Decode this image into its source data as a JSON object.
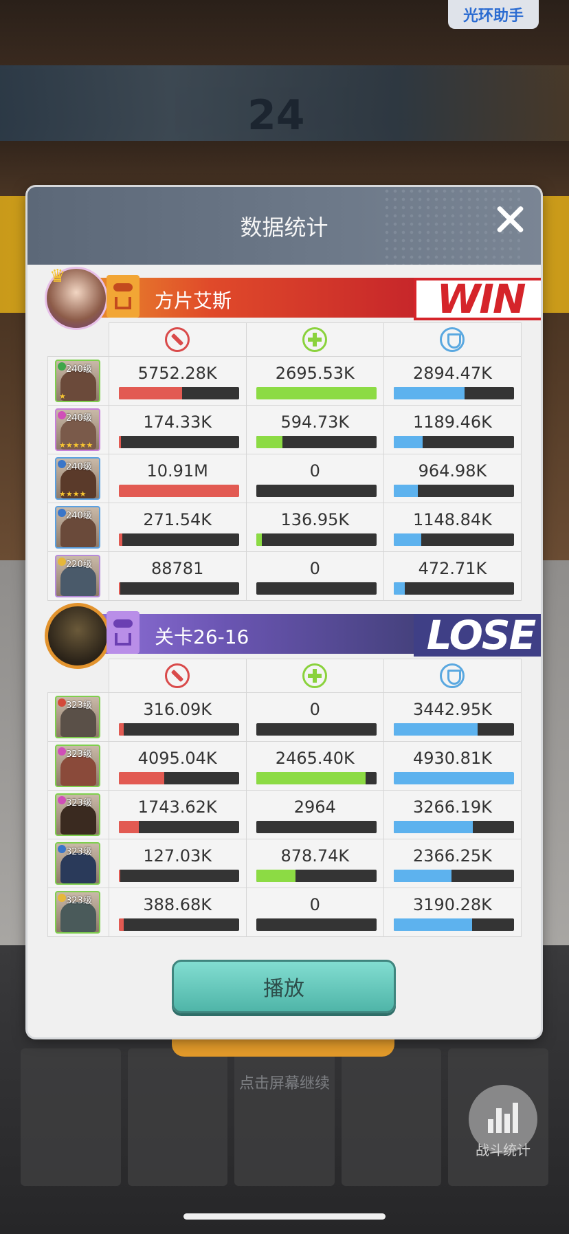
{
  "background": {
    "round_number": "24",
    "tap_hint": "点击屏幕继续",
    "stats_button_label": "战斗统计"
  },
  "halo_button": "光环助手",
  "dialog": {
    "title": "数据统计",
    "play_button": "播放"
  },
  "teams": [
    {
      "name": "方片艾斯",
      "result": "WIN",
      "stat_icons": [
        "sword-icon",
        "cross-icon",
        "shield-icon"
      ],
      "heroes": [
        {
          "level": "240级",
          "stars": "★",
          "badge_color": "#3fa64a",
          "frame_color": "#7fcf4e",
          "face_color": "#6b4a3a",
          "damage": "5752.28K",
          "damage_ratio": 0.53,
          "heal": "2695.53K",
          "heal_ratio": 1.0,
          "tank": "2894.47K",
          "tank_ratio": 0.59
        },
        {
          "level": "240级",
          "stars": "★★★★★",
          "badge_color": "#d04fb8",
          "frame_color": "#c67fd9",
          "face_color": "#7a5a4a",
          "damage": "174.33K",
          "damage_ratio": 0.02,
          "heal": "594.73K",
          "heal_ratio": 0.22,
          "tank": "1189.46K",
          "tank_ratio": 0.24
        },
        {
          "level": "240级",
          "stars": "★★★★",
          "badge_color": "#3a76c9",
          "frame_color": "#5aa0e0",
          "face_color": "#5a3a2a",
          "damage": "10.91M",
          "damage_ratio": 1.0,
          "heal": "0",
          "heal_ratio": 0,
          "tank": "964.98K",
          "tank_ratio": 0.2
        },
        {
          "level": "240级",
          "stars": "",
          "badge_color": "#3a76c9",
          "frame_color": "#5aa0e0",
          "face_color": "#6a4a3a",
          "damage": "271.54K",
          "damage_ratio": 0.03,
          "heal": "136.95K",
          "heal_ratio": 0.05,
          "tank": "1148.84K",
          "tank_ratio": 0.23
        },
        {
          "level": "220级",
          "stars": "",
          "badge_color": "#e6b73a",
          "frame_color": "#b58ad9",
          "face_color": "#4a5a6a",
          "damage": "88781",
          "damage_ratio": 0.01,
          "heal": "0",
          "heal_ratio": 0,
          "tank": "472.71K",
          "tank_ratio": 0.09
        }
      ]
    },
    {
      "name": "关卡26-16",
      "result": "LOSE",
      "stat_icons": [
        "sword-icon",
        "cross-icon",
        "shield-icon"
      ],
      "heroes": [
        {
          "level": "323级",
          "stars": "",
          "badge_color": "#d44a3a",
          "frame_color": "#7fcf4e",
          "face_color": "#5a5048",
          "damage": "316.09K",
          "damage_ratio": 0.04,
          "heal": "0",
          "heal_ratio": 0,
          "tank": "3442.95K",
          "tank_ratio": 0.7
        },
        {
          "level": "323级",
          "stars": "",
          "badge_color": "#d04fb8",
          "frame_color": "#7fcf4e",
          "face_color": "#8a4a3a",
          "damage": "4095.04K",
          "damage_ratio": 0.38,
          "heal": "2465.40K",
          "heal_ratio": 0.91,
          "tank": "4930.81K",
          "tank_ratio": 1.0
        },
        {
          "level": "323级",
          "stars": "",
          "badge_color": "#d04fb8",
          "frame_color": "#7fcf4e",
          "face_color": "#3a2a20",
          "damage": "1743.62K",
          "damage_ratio": 0.17,
          "heal": "2964",
          "heal_ratio": 0,
          "tank": "3266.19K",
          "tank_ratio": 0.66
        },
        {
          "level": "323级",
          "stars": "",
          "badge_color": "#3a76c9",
          "frame_color": "#7fcf4e",
          "face_color": "#2a3a5a",
          "damage": "127.03K",
          "damage_ratio": 0.01,
          "heal": "878.74K",
          "heal_ratio": 0.33,
          "tank": "2366.25K",
          "tank_ratio": 0.48
        },
        {
          "level": "323级",
          "stars": "",
          "badge_color": "#e6b73a",
          "frame_color": "#7fcf4e",
          "face_color": "#4a5a5a",
          "damage": "388.68K",
          "damage_ratio": 0.04,
          "heal": "0",
          "heal_ratio": 0,
          "tank": "3190.28K",
          "tank_ratio": 0.65
        }
      ]
    }
  ]
}
